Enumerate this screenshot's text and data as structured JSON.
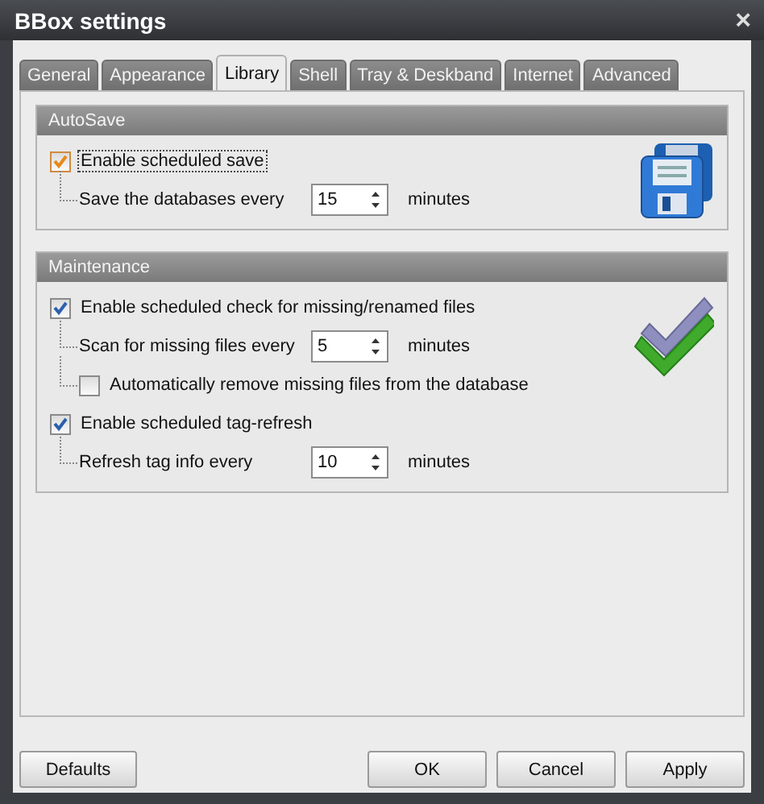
{
  "window": {
    "title": "BBox settings",
    "close": "×"
  },
  "tabs": [
    {
      "label": "General",
      "selected": false
    },
    {
      "label": "Appearance",
      "selected": false
    },
    {
      "label": "Library",
      "selected": true
    },
    {
      "label": "Shell",
      "selected": false
    },
    {
      "label": "Tray & Deskband",
      "selected": false
    },
    {
      "label": "Internet",
      "selected": false
    },
    {
      "label": "Advanced",
      "selected": false
    }
  ],
  "groups": [
    {
      "title": "AutoSave",
      "rows": [
        {
          "kind": "checkbox",
          "label": "Enable scheduled save",
          "checked": true,
          "focused": true,
          "children": [
            {
              "kind": "spin",
              "label": "Save the databases every",
              "value": "15",
              "unit": "minutes"
            }
          ]
        }
      ]
    },
    {
      "title": "Maintenance",
      "rows": [
        {
          "kind": "checkbox",
          "label": "Enable scheduled check for missing/renamed files",
          "checked": true,
          "focused": false,
          "children": [
            {
              "kind": "spin",
              "label": "Scan for missing files every",
              "value": "5",
              "unit": "minutes"
            },
            {
              "kind": "checkbox",
              "label": "Automatically remove missing files from the database",
              "checked": false,
              "focused": false
            }
          ]
        },
        {
          "kind": "checkbox",
          "label": "Enable scheduled tag-refresh",
          "checked": true,
          "focused": false,
          "children": [
            {
              "kind": "spin",
              "label": "Refresh tag info every",
              "value": "10",
              "unit": "minutes"
            }
          ]
        }
      ]
    }
  ],
  "buttons": {
    "left": [
      "Defaults"
    ],
    "right": [
      "OK",
      "Cancel",
      "Apply"
    ]
  }
}
